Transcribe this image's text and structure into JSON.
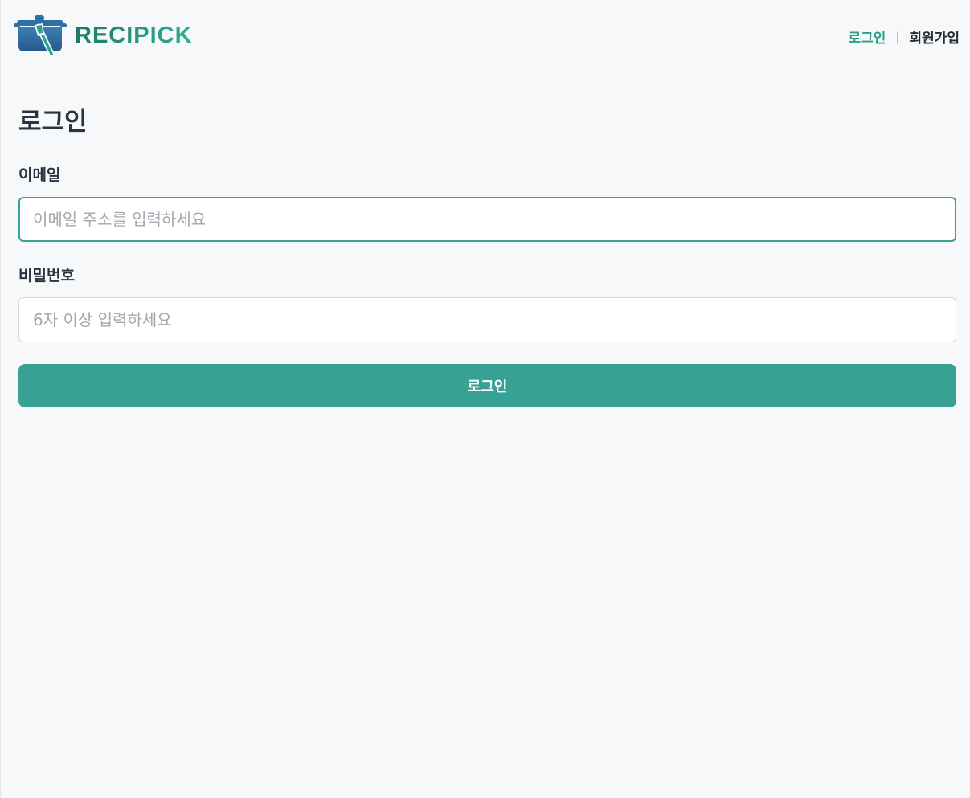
{
  "header": {
    "logo_text": "RECIPICK",
    "logo_icon": "cooking-pot-icon",
    "nav": {
      "login_label": "로그인",
      "separator": "|",
      "signup_label": "회원가입"
    }
  },
  "form": {
    "title": "로그인",
    "email": {
      "label": "이메일",
      "value": "",
      "placeholder": "이메일 주소를 입력하세요"
    },
    "password": {
      "label": "비밀번호",
      "value": "",
      "placeholder": "6자 이상 입력하세요"
    },
    "submit_label": "로그인"
  },
  "colors": {
    "brand": "#37a293",
    "brand_dark": "#1f7a66",
    "logo_pot": "#2f6fa8",
    "background": "#f7f8fa",
    "text": "#2b3240",
    "placeholder": "#a3a7ae"
  }
}
